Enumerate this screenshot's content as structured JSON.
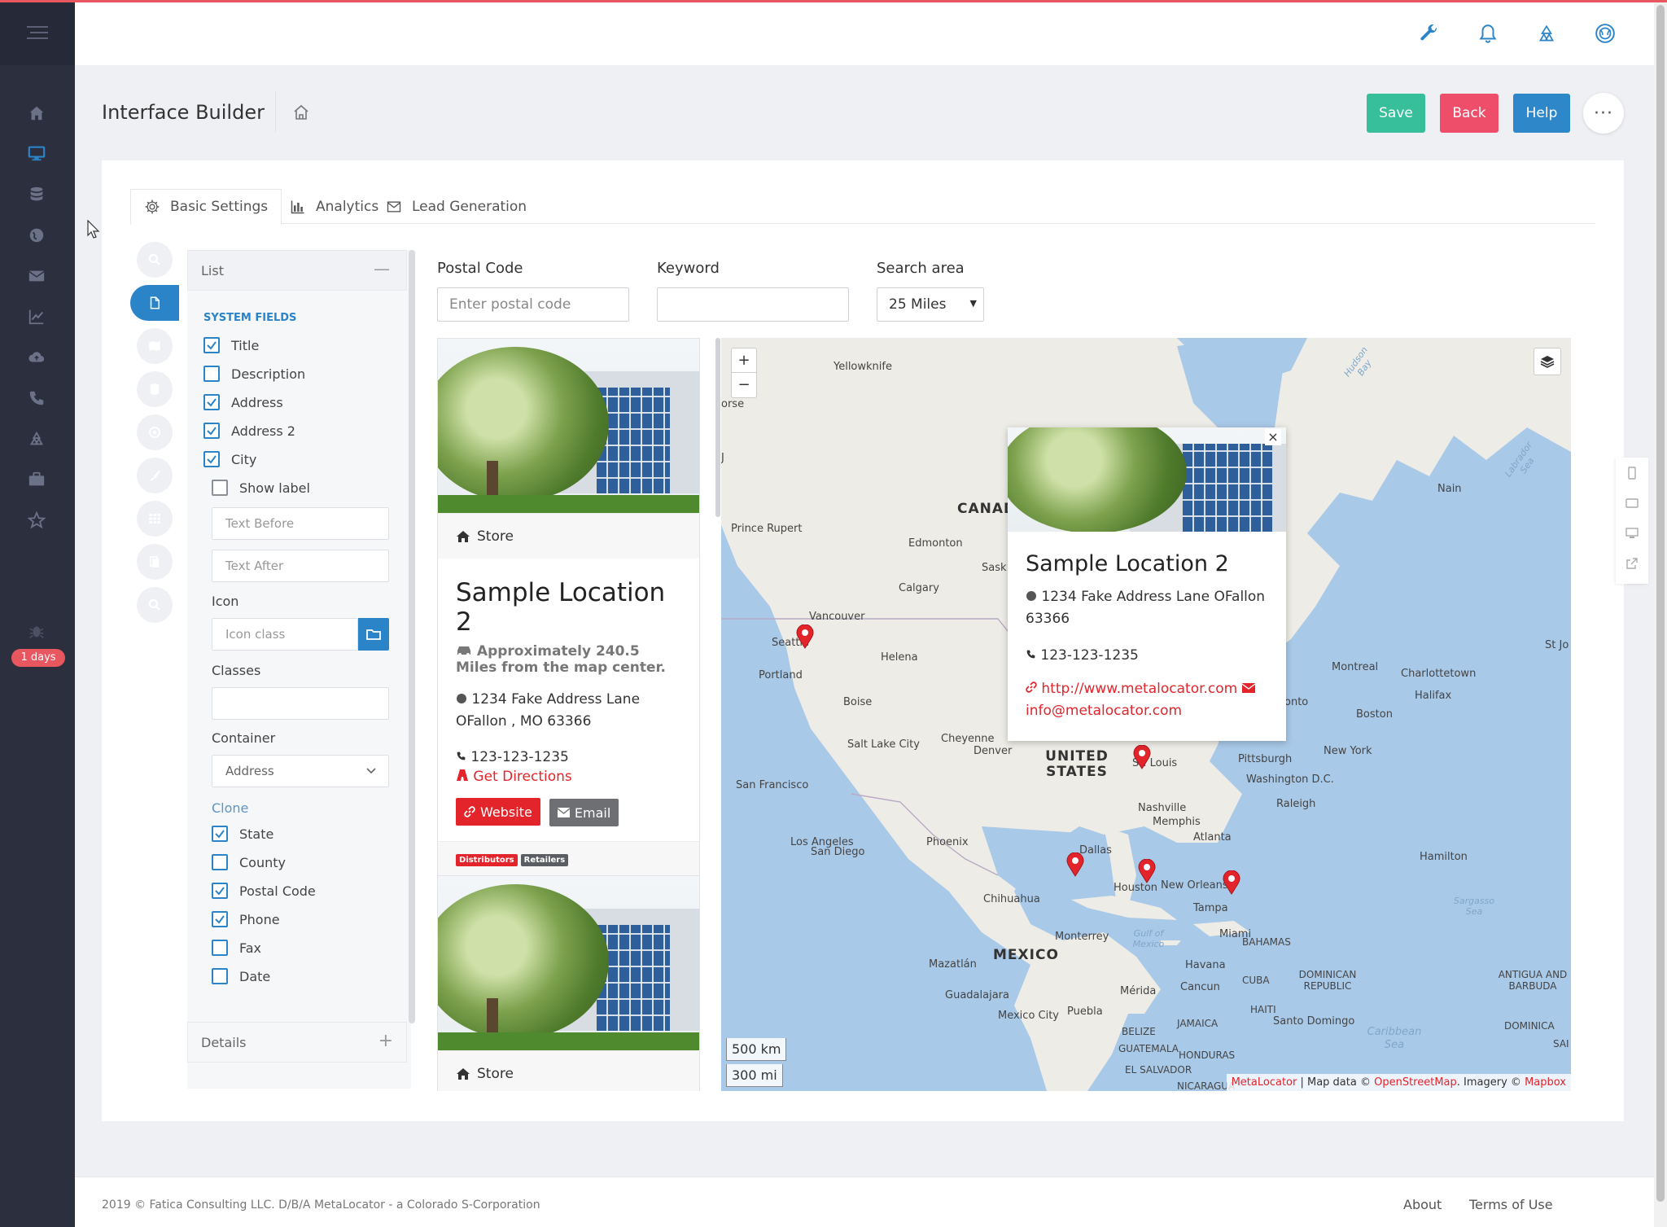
{
  "app": {
    "page_title": "Interface Builder",
    "trial_badge": "1 days"
  },
  "nav_icons": [
    "menu-icon",
    "home-icon",
    "desktop-icon",
    "database-icon",
    "globe-icon",
    "envelope-icon",
    "chart-icon",
    "cloud-icon",
    "phone-icon",
    "recycle-icon",
    "briefcase-icon",
    "star-icon",
    "bug-icon"
  ],
  "header_buttons": {
    "save": "Save",
    "back": "Back",
    "help": "Help",
    "more": "···"
  },
  "colors": {
    "save": "#36bf9a",
    "back": "#ee4e69",
    "help": "#2d87c8",
    "accent": "#2b84c8",
    "danger": "#e3242b",
    "topline": "#e8565f"
  },
  "tabs": [
    {
      "label": "Basic Settings",
      "active": true
    },
    {
      "label": "Analytics",
      "active": false
    },
    {
      "label": "Lead Generation",
      "active": false
    }
  ],
  "settings": {
    "panel_title": "List",
    "section_label": "SYSTEM FIELDS",
    "fields": [
      {
        "label": "Title",
        "checked": true
      },
      {
        "label": "Description",
        "checked": false
      },
      {
        "label": "Address",
        "checked": true
      },
      {
        "label": "Address 2",
        "checked": true
      },
      {
        "label": "City",
        "checked": true
      }
    ],
    "show_label": {
      "label": "Show label",
      "checked": false
    },
    "text_before_placeholder": "Text Before",
    "text_after_placeholder": "Text After",
    "icon_label": "Icon",
    "icon_placeholder": "Icon class",
    "classes_label": "Classes",
    "container_label": "Container",
    "container_value": "Address",
    "clone_link": "Clone",
    "fields2": [
      {
        "label": "State",
        "checked": true
      },
      {
        "label": "County",
        "checked": false
      },
      {
        "label": "Postal Code",
        "checked": true
      },
      {
        "label": "Phone",
        "checked": true
      },
      {
        "label": "Fax",
        "checked": false
      },
      {
        "label": "Date",
        "checked": false
      }
    ],
    "details_title": "Details"
  },
  "search": {
    "postal_label": "Postal Code",
    "postal_placeholder": "Enter postal code",
    "keyword_label": "Keyword",
    "keyword_value": "",
    "area_label": "Search area",
    "area_value": "25 Miles"
  },
  "result": {
    "category": "Store",
    "name": "Sample Location 2",
    "approx": "Approximately 240.5 Miles from the map center.",
    "address_line1": "1234 Fake Address Lane",
    "address_line2": "OFallon , MO 63366",
    "phone": "123-123-1235",
    "directions": "Get Directions",
    "website_btn": "Website",
    "email_btn": "Email",
    "tag1": "Distributors",
    "tag2": "Retailers",
    "second_category": "Store"
  },
  "popup": {
    "name": "Sample Location 2",
    "address": "1234 Fake Address Lane OFallon 63366",
    "phone": "123-123-1235",
    "website": "http://www.metalocator.com",
    "email": "info@metalocator.com",
    "close": "×"
  },
  "map": {
    "zoom_in": "+",
    "zoom_out": "−",
    "scale_km": "500 km",
    "scale_mi": "300 mi",
    "attribution_brand": "MetaLocator",
    "attribution_mid": " | Map data © ",
    "attribution_osm": "OpenStreetMap",
    "attribution_imagery": ". Imagery © ",
    "attribution_mapbox": "Mapbox",
    "labels": {
      "yellowknife": "Yellowknife",
      "orse": "orse",
      "canada": "CANAD",
      "prince_rupert": "Prince Rupert",
      "edmonton": "Edmonton",
      "sask": "Sask",
      "calgary": "Calgary",
      "vancouver": "Vancouver",
      "seattle": "Seattle",
      "portland": "Portland",
      "helena": "Helena",
      "boise": "Boise",
      "salt_lake": "Salt Lake City",
      "cheyenne": "Cheyenne",
      "denver": "Denver",
      "united_states": "UNITED STATES",
      "st_louis": "St. Louis",
      "san_francisco": "San Francisco",
      "los_angeles": "Los Angeles",
      "san_diego": "San Diego",
      "phoenix": "Phoenix",
      "dallas": "Dallas",
      "houston": "Houston",
      "new_orleans": "New Orleans",
      "nashville": "Nashville",
      "memphis": "Memphis",
      "atlanta": "Atlanta",
      "tampa": "Tampa",
      "miami": "Miami",
      "chihuahua": "Chihuahua",
      "monterrey": "Monterrey",
      "mexico": "MEXICO",
      "mazatlan": "Mazatlán",
      "guadalajara": "Guadalajara",
      "mexico_city": "Mexico City",
      "puebla": "Puebla",
      "merida": "Mérida",
      "cancun": "Cancun",
      "havana": "Havana",
      "cuba": "CUBA",
      "belize": "BELIZE",
      "guatemala": "GUATEMALA",
      "honduras": "HONDURAS",
      "el_salvador": "EL SALVADOR",
      "nicaragua": "NICARAGUA",
      "jamaica": "JAMAICA",
      "haiti": "HAITI",
      "santo_domingo": "Santo Domingo",
      "dominican": "DOMINICAN REPUBLIC",
      "bahamas": "BAHAMAS",
      "hamilton": "Hamilton",
      "antigua": "ANTIGUA AND BARBUDA",
      "dominica": "DOMINICA",
      "sai": "SAI",
      "caribbean": "Caribbean Sea",
      "gulf": "Gulf of Mexico",
      "sargasso": "Sargasso Sea",
      "labrador": "Labrador Sea",
      "hudson": "Hudson Bay",
      "nain": "Nain",
      "st_jo": "St Jo",
      "montreal": "Montreal",
      "charlottetown": "Charlottetown",
      "halifax": "Halifax",
      "ontario": "onto",
      "boston": "Boston",
      "new_york": "New York",
      "pittsburgh": "Pittsburgh",
      "washington": "Washington D.C.",
      "raleigh": "Raleigh",
      "j_left": "J"
    }
  },
  "footer": {
    "copyright": "2019 © Fatica Consulting LLC. D/B/A MetaLocator - a Colorado S-Corporation",
    "about": "About",
    "terms": "Terms of Use"
  }
}
